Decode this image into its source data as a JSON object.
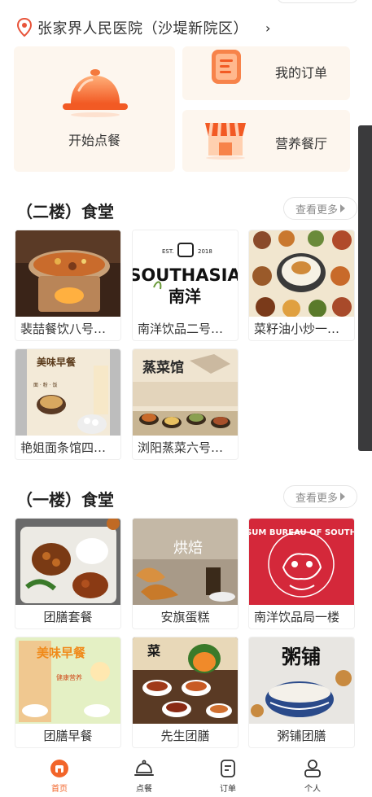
{
  "location": {
    "name": "张家界人民医院（沙堤新院区）"
  },
  "features": {
    "start_order": "开始点餐",
    "my_orders": "我的订单",
    "nutrition": "营养餐厅"
  },
  "sections": [
    {
      "title": "（二楼）食堂",
      "more": "查看更多",
      "items": [
        "裴喆餐饮八号窗口",
        "南洋饮品二号窗口",
        "菜籽油小炒一号窗口",
        "艳姐面条馆四号窗口",
        "浏阳蒸菜六号窗口"
      ]
    },
    {
      "title": "（一楼）食堂",
      "more": "查看更多",
      "items": [
        "团膳套餐",
        "安旗蛋糕",
        "南洋饮品局一楼",
        "团膳早餐",
        "先生团膳",
        "粥铺团膳"
      ]
    }
  ],
  "image_text": {
    "southasia_est": "EST.",
    "southasia_year": "2018",
    "southasia": "SOUTHASIA",
    "southasia_cn": "南洋",
    "noodle_top": "美味早餐",
    "noodle_menu": "面 · 粉 · 饭",
    "steam": "蒸菜馆",
    "bake": "烘焙",
    "sumbureau": "SUM BUREAU OF SOUTH",
    "breakfast": "美味早餐",
    "breakfast_sub": "健康营养",
    "gentleman": "菜",
    "porridge": "粥铺"
  },
  "nav": [
    {
      "label": "首页",
      "icon": "home-icon",
      "active": true
    },
    {
      "label": "点餐",
      "icon": "cloche-icon",
      "active": false
    },
    {
      "label": "订单",
      "icon": "order-icon",
      "active": false
    },
    {
      "label": "个人",
      "icon": "user-icon",
      "active": false
    }
  ],
  "colors": {
    "accent": "#f2652a",
    "card_bg": "#fdf6ee"
  }
}
